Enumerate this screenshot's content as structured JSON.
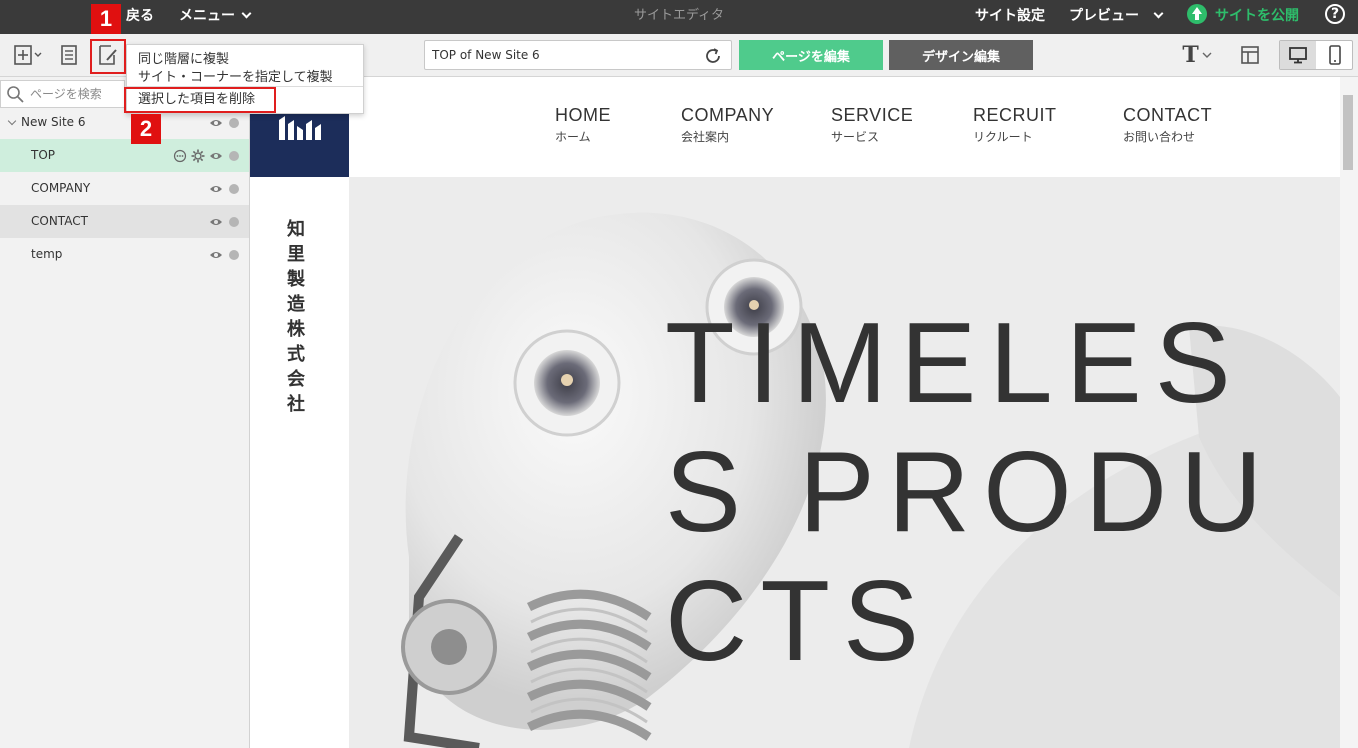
{
  "topbar": {
    "back_label": "戻る",
    "menu_label": "メニュー",
    "title": "サイトエディタ",
    "site_settings_label": "サイト設定",
    "preview_label": "プレビュー",
    "publish_label": "サイトを公開",
    "help_symbol": "?"
  },
  "toolbar": {
    "url_value": "TOP of New Site 6",
    "edit_page_label": "ページを編集",
    "design_edit_label": "デザイン編集",
    "font_symbol": "T"
  },
  "dropdown": {
    "items": [
      "同じ階層に複製",
      "サイト・コーナーを指定して複製",
      "選択した項目を削除"
    ]
  },
  "annotations": {
    "badge1": "1",
    "badge2": "2",
    "color": "#e01e1e"
  },
  "sidebar": {
    "search_placeholder": "ページを検索",
    "tree": [
      {
        "label": "New Site 6",
        "level": "root"
      },
      {
        "label": "TOP",
        "selected": true
      },
      {
        "label": "COMPANY"
      },
      {
        "label": "CONTACT",
        "hovered": true
      },
      {
        "label": "temp"
      }
    ]
  },
  "site": {
    "nav": [
      {
        "en": "HOME",
        "ja": "ホーム"
      },
      {
        "en": "COMPANY",
        "ja": "会社案内"
      },
      {
        "en": "SERVICE",
        "ja": "サービス"
      },
      {
        "en": "RECRUIT",
        "ja": "リクルート"
      },
      {
        "en": "CONTACT",
        "ja": "お問い合わせ"
      }
    ],
    "company_name": "知里製造株式会社",
    "hero_text": "TIMELESS PRODUCTS",
    "logo_color": "#1c2d5a"
  },
  "colors": {
    "accent_green": "#4fcb8c",
    "publish_green": "#2ebd6b",
    "topbar_bg": "#3a3a3a",
    "selected_row": "#cfeedd",
    "hover_row": "#e2e2e2"
  }
}
